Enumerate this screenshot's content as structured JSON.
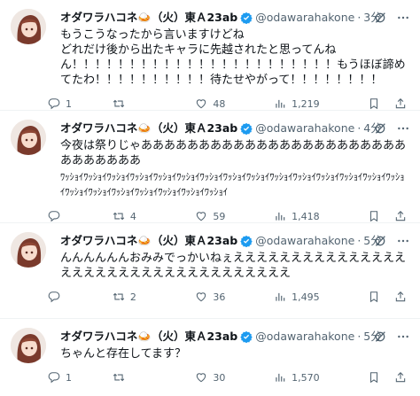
{
  "tweets": [
    {
      "name": "オダワラハコネ",
      "name_emoji": "🍛",
      "name_suffix": "（火）東Ａ23ab",
      "handle": "@odawarahakone",
      "dot": "·",
      "time": "3分",
      "text": "もうこうなったから言いますけどね\nどれだけ後から出たキャラに先越されたと思ってんねん！！！！！！！！！！！！！！！！！！！！！！！もうほぼ諦めてたわ！！！！！！！！！！待たせやがって！！！！！！！！",
      "small": "",
      "reply": "1",
      "retweet": "",
      "like": "48",
      "views": "1,219"
    },
    {
      "name": "オダワラハコネ",
      "name_emoji": "🍛",
      "name_suffix": "（火）東Ａ23ab",
      "handle": "@odawarahakone",
      "dot": "·",
      "time": "4分",
      "text": "今夜は祭りじゃああああああああああああああああああああああああああああああ",
      "small": "ﾜｯｼｮｲﾜｯｼｮｲﾜｯｼｮｲﾜｯｼｮｲﾜｯｼｮｲﾜｯｼｮｲﾜｯｼｮｲﾜｯｼｮｲﾜｯｼｮｲﾜｯｼｮｲﾜｯｼｮｲﾜｯｼｮｲﾜｯｼｮｲﾜｯｼｮｲﾜｯｼｮｲﾜｯｼｮｲﾜｯｼｮｲﾜｯｼｮｲﾜｯｼｮｲﾜｯｼｮｲﾜｯｼｮｲﾜｯｼｮｲ",
      "reply": "",
      "retweet": "4",
      "like": "59",
      "views": "1,418"
    },
    {
      "name": "オダワラハコネ",
      "name_emoji": "🍛",
      "name_suffix": "（火）東Ａ23ab",
      "handle": "@odawarahakone",
      "dot": "·",
      "time": "5分",
      "text": "んんんんんんおみみでっかいねぇえええええええええええええええええええええええええええええええええええ",
      "small": "",
      "reply": "",
      "retweet": "2",
      "like": "36",
      "views": "1,495"
    },
    {
      "name": "オダワラハコネ",
      "name_emoji": "🍛",
      "name_suffix": "（火）東Ａ23ab",
      "handle": "@odawarahakone",
      "dot": "·",
      "time": "5分",
      "text": "ちゃんと存在してます？",
      "small": "",
      "reply": "1",
      "retweet": "",
      "like": "30",
      "views": "1,570"
    }
  ],
  "colors": {
    "verified": "#1d9bf0",
    "muted": "#536471",
    "text": "#0f1419",
    "divider": "#eff3f4"
  },
  "icons": [
    "avatar",
    "verified-badge-icon",
    "grok-icon",
    "more-icon",
    "reply-icon",
    "retweet-icon",
    "like-icon",
    "views-icon",
    "bookmark-icon",
    "share-icon"
  ]
}
